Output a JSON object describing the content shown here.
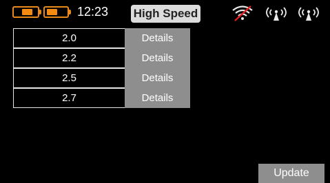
{
  "status_bar": {
    "time": "12:23",
    "mode": "High Speed",
    "accent_color": "#f58a10",
    "batteries": [
      {
        "icon": "battery-icon",
        "level": 0.45
      },
      {
        "icon": "battery-icon",
        "level": 0.45
      }
    ],
    "signal_icons": [
      "wifi-off-icon",
      "antenna-icon",
      "antenna-icon"
    ]
  },
  "table": {
    "rows": [
      {
        "value": "2.0",
        "action": "Details"
      },
      {
        "value": "2.2",
        "action": "Details"
      },
      {
        "value": "2.5",
        "action": "Details"
      },
      {
        "value": "2.7",
        "action": "Details"
      }
    ]
  },
  "footer": {
    "update_label": "Update"
  }
}
